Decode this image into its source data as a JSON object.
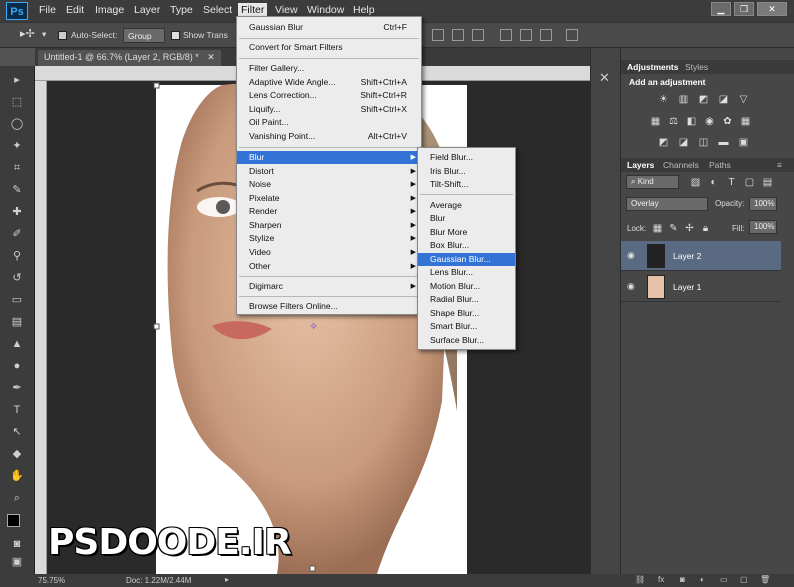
{
  "menubar": {
    "logo": "Ps",
    "items": [
      "File",
      "Edit",
      "Image",
      "Layer",
      "Type",
      "Select",
      "Filter",
      "View",
      "Window",
      "Help"
    ],
    "active_item": "Filter"
  },
  "options": {
    "auto_select_label": "Auto-Select:",
    "auto_select_value": "Group",
    "show_transform_label": "Show Trans"
  },
  "document": {
    "tab_title": "Untitled-1 @ 66.7% (Layer 2, RGB/8) *"
  },
  "filter_menu": {
    "items": [
      {
        "label": "Gaussian Blur",
        "shortcut": "Ctrl+F"
      },
      {
        "label": "Convert for Smart Filters"
      },
      {
        "label": "Filter Gallery..."
      },
      {
        "label": "Adaptive Wide Angle...",
        "shortcut": "Shift+Ctrl+A"
      },
      {
        "label": "Lens Correction...",
        "shortcut": "Shift+Ctrl+R"
      },
      {
        "label": "Liquify...",
        "shortcut": "Shift+Ctrl+X"
      },
      {
        "label": "Oil Paint..."
      },
      {
        "label": "Vanishing Point...",
        "shortcut": "Alt+Ctrl+V"
      },
      {
        "label": "Blur",
        "submenu": true
      },
      {
        "label": "Distort",
        "submenu": true
      },
      {
        "label": "Noise",
        "submenu": true
      },
      {
        "label": "Pixelate",
        "submenu": true
      },
      {
        "label": "Render",
        "submenu": true
      },
      {
        "label": "Sharpen",
        "submenu": true
      },
      {
        "label": "Stylize",
        "submenu": true
      },
      {
        "label": "Video",
        "submenu": true
      },
      {
        "label": "Other",
        "submenu": true
      },
      {
        "label": "Digimarc",
        "submenu": true
      },
      {
        "label": "Browse Filters Online..."
      }
    ],
    "highlighted": "Blur"
  },
  "blur_menu": {
    "items": [
      "Field Blur...",
      "Iris Blur...",
      "Tilt-Shift...",
      "Average",
      "Blur",
      "Blur More",
      "Box Blur...",
      "Gaussian Blur...",
      "Lens Blur...",
      "Motion Blur...",
      "Radial Blur...",
      "Shape Blur...",
      "Smart Blur...",
      "Surface Blur..."
    ],
    "highlighted": "Gaussian Blur..."
  },
  "adjustments": {
    "tabs": [
      "Adjustments",
      "Styles"
    ],
    "heading": "Add an adjustment"
  },
  "layers_panel": {
    "tabs": [
      "Layers",
      "Channels",
      "Paths"
    ],
    "filter_value": "Kind",
    "blend_mode": "Overlay",
    "opacity_label": "Opacity:",
    "opacity_value": "100%",
    "lock_label": "Lock:",
    "fill_label": "Fill:",
    "fill_value": "100%",
    "layers": [
      {
        "name": "Layer 2",
        "selected": true
      },
      {
        "name": "Layer 1",
        "selected": false
      }
    ]
  },
  "status": {
    "zoom": "75.75%",
    "doc_info": "Doc: 1.22M/2.44M"
  },
  "watermark": "PSDOODE.IR",
  "colors": {
    "menu_highlight": "#3373d6",
    "ps_blue": "#3aa9f5",
    "layer_selected": "#5a6a82"
  }
}
